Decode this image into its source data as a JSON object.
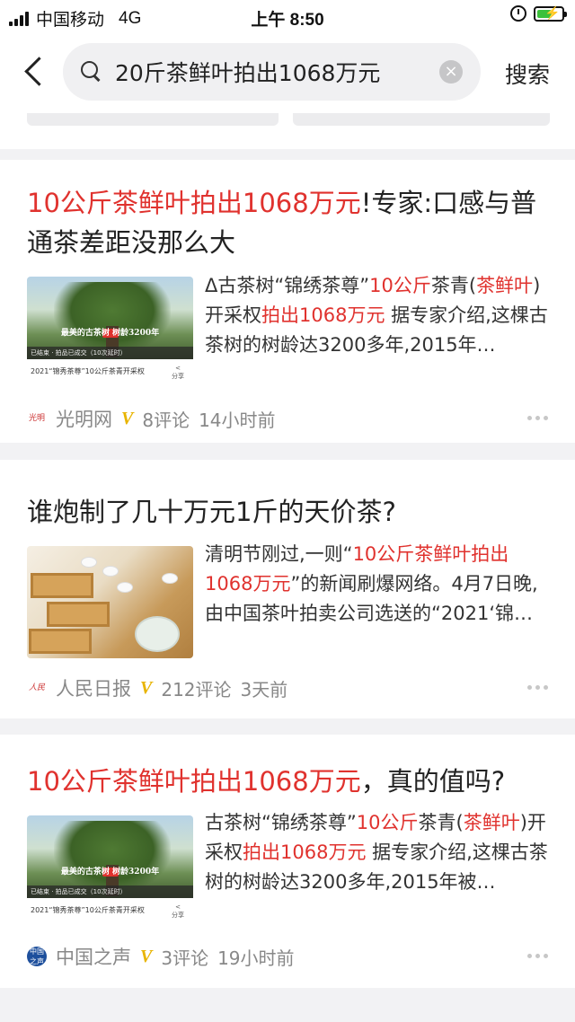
{
  "status_bar": {
    "carrier": "中国移动",
    "network": "4G",
    "time": "上午 8:50"
  },
  "search": {
    "query": "20斤茶鲜叶拍出1068万元",
    "clear_symbol": "×",
    "submit_label": "搜索"
  },
  "articles": [
    {
      "title_hl": "10公斤茶鲜叶拍出1068万元",
      "title_rest": "!专家:口感与普通茶差距没那么大",
      "snippet": [
        {
          "t": "Δ古茶树“锦绣茶尊”",
          "h": false
        },
        {
          "t": "10公斤",
          "h": true
        },
        {
          "t": "茶青(",
          "h": false
        },
        {
          "t": "茶鲜叶",
          "h": true
        },
        {
          "t": ")开采权",
          "h": false
        },
        {
          "t": "拍出1068万元",
          "h": true
        },
        {
          "t": " 据专家介绍,这棵古茶树的树龄达3200多年,2015年…",
          "h": false
        }
      ],
      "thumb": {
        "caption": "最美的古茶树 树龄3200年",
        "bar": "已结束 · 拍品已成交（10次延时）",
        "foot": "2021“锦秀茶尊”10公斤茶青开采权",
        "share": "分享"
      },
      "source": "光明网",
      "verified": "V",
      "comments": "8评论",
      "time": "14小时前"
    },
    {
      "title_plain": "谁炮制了几十万元1斤的天价茶?",
      "snippet": [
        {
          "t": "清明节刚过,一则“",
          "h": false
        },
        {
          "t": "10公斤茶鲜叶拍出1068万元",
          "h": true
        },
        {
          "t": "”的新闻刷爆网络。4月7日晚,由中国茶叶拍卖公司选送的“2021‘锦…",
          "h": false
        }
      ],
      "source": "人民日报",
      "verified": "V",
      "comments": "212评论",
      "time": "3天前"
    },
    {
      "title_hl": "10公斤茶鲜叶拍出1068万元",
      "title_rest": "，真的值吗?",
      "snippet": [
        {
          "t": "古茶树“锦绣茶尊”",
          "h": false
        },
        {
          "t": "10公斤",
          "h": true
        },
        {
          "t": "茶青(",
          "h": false
        },
        {
          "t": "茶鲜叶",
          "h": true
        },
        {
          "t": ")开采权",
          "h": false
        },
        {
          "t": "拍出1068万元",
          "h": true
        },
        {
          "t": " 据专家介绍,这棵古茶树的树龄达3200多年,2015年被…",
          "h": false
        }
      ],
      "thumb": {
        "caption": "最美的古茶树 树龄3200年",
        "bar": "已结束 · 拍品已成交（10次延时）",
        "foot": "2021“锦秀茶尊”10公斤茶青开采权",
        "share": "分享"
      },
      "source": "中国之声",
      "verified": "V",
      "comments": "3评论",
      "time": "19小时前"
    }
  ],
  "colors": {
    "highlight": "#e0322e",
    "verified": "#e8b400",
    "meta": "#888888"
  }
}
